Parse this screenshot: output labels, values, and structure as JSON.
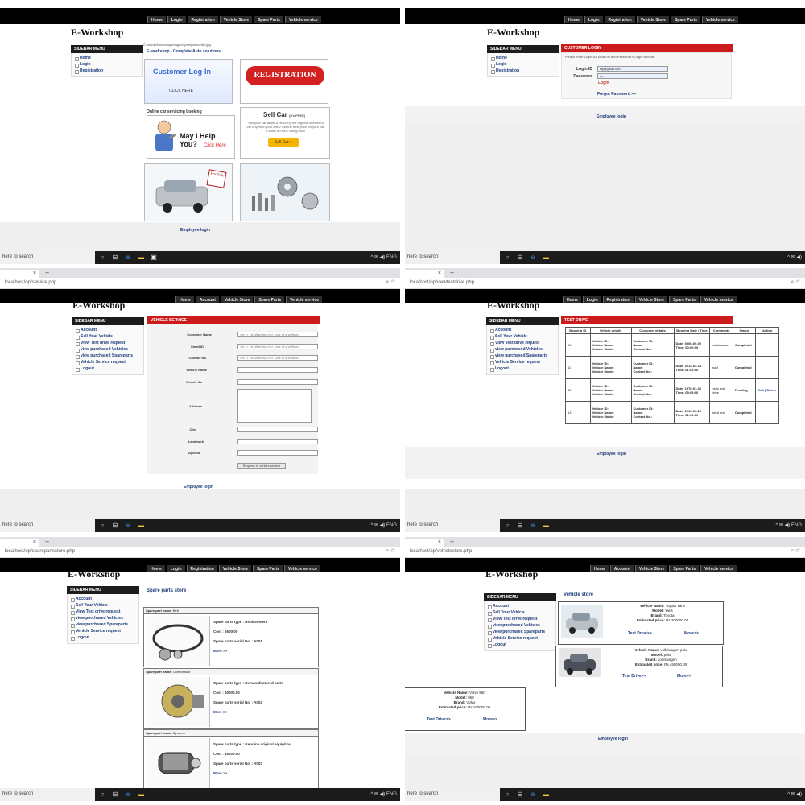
{
  "common": {
    "brand": "E-Workshop",
    "sidebar_head": "SIDEBAR MENU",
    "employee_login": "Employee login",
    "taskbar_search": "here to search",
    "taskbar_lang": "ENG"
  },
  "panel0": {
    "nav": [
      "Home",
      "Login",
      "Registration",
      "Vehicle Store",
      "Spare Parts",
      "Vehicle service"
    ],
    "sidebar": [
      "Home",
      "Login",
      "Registration"
    ],
    "path": "C:\\wamp\\htdocs\\op\\images\\sparepartsorder.jpg",
    "subtitle": "E-workshop - Complete Auto solutions",
    "login_tile": "Customer Log-In",
    "login_tile_sub": "CLICK HERE",
    "registration": "REGISTRATION",
    "online_booking": "Online car servicing booking",
    "help_text": "May I Help You?",
    "help_sub": "Click Here",
    "sell_title": "Sell Car",
    "sell_free": "(It's FREE)",
    "sell_desc": "Sell your car faster & reaching the highest number of car buyers in your area! Get the best price for your car. Create a FREE listing now!",
    "sell_btn": "Sell Car »",
    "for_sale": "For Sale"
  },
  "panel1": {
    "nav": [
      "Home",
      "Login",
      "Registration",
      "Vehicle Store",
      "Spare Parts",
      "Vehicle service"
    ],
    "sidebar": [
      "Home",
      "Login",
      "Registration"
    ],
    "header": "CUSTOMER LOGIN",
    "hint": "Please enter Login ID/ Email ID and Password to login website.",
    "login_label": "Login ID",
    "login_value": "raj@gmail.com",
    "password_label": "Password",
    "password_value": "•••",
    "login_btn": "Login",
    "forgot": "Forgot Password >>"
  },
  "panel2": {
    "url": "localhost/op/service.php",
    "nav": [
      "Home",
      "Account",
      "Vehicle Store",
      "Spare Parts",
      "Vehicle service"
    ],
    "sidebar": [
      "Account",
      "Sell Your Vehicle",
      "View Test drive request",
      "view purchased Vehicles",
      "view purchased Spareparts",
      "Vehicle Service request",
      "Logout"
    ],
    "header": "VEHICLE SERVICE",
    "fields": [
      "Customer Name",
      "Email ID",
      "Contact No.",
      "Vehicle Name",
      "Vehicle No",
      "Address",
      "City",
      "Landmark",
      "Zipcode"
    ],
    "warning": "<br />\n<b>Warning</b>: Use of undefined",
    "submit": "Request to vehicle service"
  },
  "panel3": {
    "url": "localhost/op/viewtestdrive.php",
    "nav": [
      "Home",
      "Login",
      "Registration",
      "Vehicle Store",
      "Spare Parts",
      "Vehicle service"
    ],
    "sidebar": [
      "Account",
      "Sell Your Vehicle",
      "View Test drive request",
      "view purchased Vehicles",
      "view purchased Spareparts",
      "Vehicle Service request",
      "Logout"
    ],
    "header": "TEST DRIVE",
    "columns": [
      "Booking ID",
      "Vehicle details",
      "Customer details",
      "Booking Date / Time",
      "Comments",
      "Status",
      "Action"
    ],
    "vehicle_lines": [
      "Vehicle ID:",
      "Vehicle Name:",
      "Vehicle Model:"
    ],
    "customer_lines": [
      "Customer ID:",
      "Name:",
      "Contact No.:"
    ],
    "rows": [
      {
        "id": "10",
        "date": "Date: 0000-00-00",
        "time": "Time: 00:00:00",
        "comments": "adfafaaaaa",
        "status": "Completed",
        "action": ""
      },
      {
        "id": "11",
        "date": "Date: 2013-03-14",
        "time": "Time: 01:02:00",
        "comments": "adsf",
        "status": "Completed",
        "action": ""
      },
      {
        "id": "12",
        "date": "Date: 1970-01-01",
        "time": "Time: 05:05:00",
        "comments": "hello test drive",
        "status": "Pending",
        "action": "Edit | Delete"
      },
      {
        "id": "13",
        "date": "Date: 2013-03-21",
        "time": "Time: 01:01:00",
        "comments": "abcd test",
        "status": "Completed",
        "action": ""
      }
    ]
  },
  "panel4": {
    "url": "localhost/op/sparepartsstore.php",
    "nav": [
      "Home",
      "Login",
      "Registration",
      "Vehicle Store",
      "Spare Parts",
      "Vehicle service"
    ],
    "sidebar": [
      "Account",
      "Sell Your Vehicle",
      "View Test drive request",
      "view purchased Vehicles",
      "view purchased Spareparts",
      "Vehicle Service request",
      "Logout"
    ],
    "title": "Spare parts store",
    "items": [
      {
        "name_label": "Spare part name:",
        "name": "Belt",
        "type": "Spare parts type : Replacement",
        "cost": "Cost : 5500.00",
        "serial": "Spare parts serial No. : A001",
        "more": "More >>"
      },
      {
        "name_label": "Spare part name:",
        "name": "Compressor",
        "type": "Spare parts type : Remanufactured parts",
        "cost": "Cost : 50000.00",
        "serial": "Spare parts serial No. : A002",
        "more": "More >>"
      },
      {
        "name_label": "Spare part name:",
        "name": "Dynamo",
        "type": "Spare parts type : Genuine original equiptice",
        "cost": "Cost : 15000.00",
        "serial": "Spare parts serial No. : A003",
        "more": "More >>"
      }
    ]
  },
  "panel5": {
    "url": "localhost/op/vehiclestore.php",
    "nav": [
      "Home",
      "Account",
      "Vehicle Store",
      "Spare Parts",
      "Vehicle service"
    ],
    "sidebar": [
      "Account",
      "Sell Your Vehicle",
      "View Test drive request",
      "view purchased Vehicles",
      "view purchased Spareparts",
      "Vehicle Service request",
      "Logout"
    ],
    "title": "Vehicle store",
    "vehicles": [
      {
        "name": "Toyota Yaris",
        "model": "Yaris",
        "brand": "Toyota",
        "price": "Rs.200000.00",
        "test": "Test Drive>>",
        "more": "More>>"
      },
      {
        "name": "volkswagen polo",
        "model": "polo",
        "brand": "volkswagen",
        "price": "Rs.450000.00",
        "test": "Test Drive>>",
        "more": "More>>"
      },
      {
        "name": "Volvo 960",
        "model": "960",
        "brand": "Volvo",
        "price": "Rs.100000.00",
        "test": "Test Drive>>",
        "more": "More>>"
      }
    ],
    "labels": {
      "name": "Vehicle Name:",
      "model": "Model:",
      "brand": "Brand:",
      "price": "Estimated price:"
    }
  }
}
